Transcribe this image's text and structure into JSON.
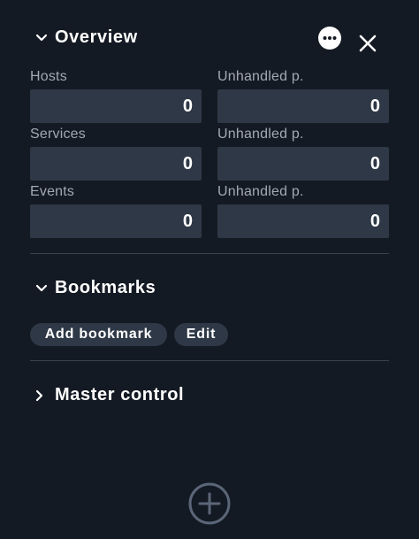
{
  "overview": {
    "title": "Overview",
    "menu_icon": "more-horizontal-icon",
    "close_icon": "close-icon",
    "rows": [
      {
        "label": "Hosts",
        "value": "0",
        "unhandled_label": "Unhandled p.",
        "unhandled_value": "0"
      },
      {
        "label": "Services",
        "value": "0",
        "unhandled_label": "Unhandled p.",
        "unhandled_value": "0"
      },
      {
        "label": "Events",
        "value": "0",
        "unhandled_label": "Unhandled p.",
        "unhandled_value": "0"
      }
    ]
  },
  "bookmarks": {
    "title": "Bookmarks",
    "add_label": "Add bookmark",
    "edit_label": "Edit"
  },
  "master_control": {
    "title": "Master control",
    "expanded": false
  },
  "footer": {
    "add_icon": "add-circle-icon"
  },
  "colors": {
    "background": "#141a23",
    "box": "#2e3846",
    "label": "#a3a9b4",
    "divider": "#3a4250"
  }
}
